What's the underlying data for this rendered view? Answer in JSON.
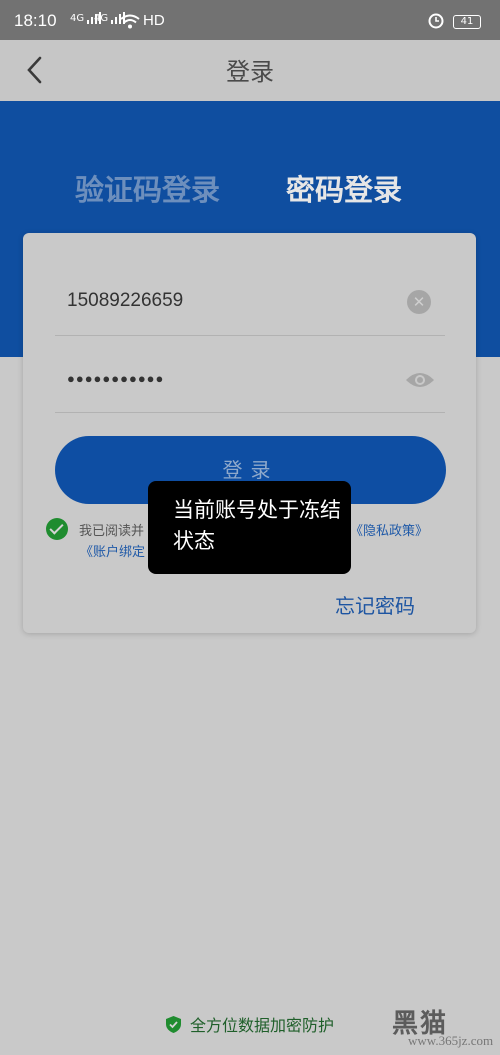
{
  "status_bar": {
    "time": "18:10",
    "signal1": "4G",
    "signal2": "4G",
    "network": "HD",
    "battery": "41",
    "icons": [
      "signal-icon",
      "wifi-icon",
      "alarm-icon",
      "battery-icon"
    ]
  },
  "nav": {
    "title": "登录",
    "back_icon": "chevron-left-icon"
  },
  "tabs": [
    {
      "label": "验证码登录",
      "active": false
    },
    {
      "label": "密码登录",
      "active": true
    }
  ],
  "form": {
    "phone_value": "15089226659",
    "password_value": "●●●●●●●●●●●",
    "clear_icon": "clear-icon",
    "eye_icon": "eye-icon",
    "login_label": "登录",
    "agreement_prefix": "我已阅读并",
    "privacy_link": "《隐私政策》",
    "binding_link": "《账户绑定",
    "forgot_label": "忘记密码"
  },
  "toast": {
    "message": "当前账号处于冻结状态"
  },
  "footer": {
    "text": "全方位数据加密防护",
    "icon": "shield-check-icon"
  },
  "watermark": {
    "brand": "黑猫",
    "url": "www.365jz.com"
  },
  "colors": {
    "primary": "#0f4ea0",
    "status_bar": "#727272",
    "overlay_bg": "#c9c9c9",
    "success": "#1f8c2f"
  }
}
